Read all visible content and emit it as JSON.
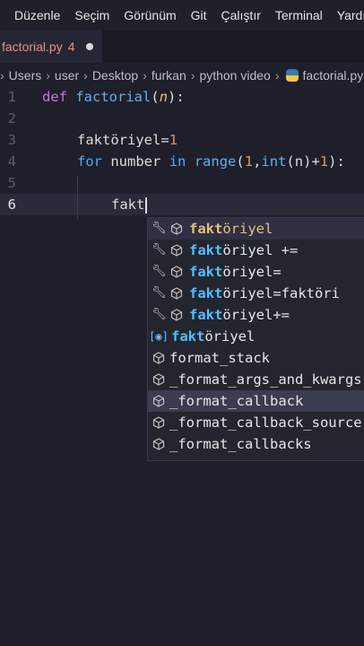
{
  "menu": [
    "Düzenle",
    "Seçim",
    "Görünüm",
    "Git",
    "Çalıştır",
    "Terminal",
    "Yardım"
  ],
  "tab": {
    "name": "factorial.py",
    "problems": "4"
  },
  "breadcrumb": [
    "Users",
    "user",
    "Desktop",
    "furkan",
    "python video",
    "factorial.py"
  ],
  "code": {
    "line_numbers": [
      "1",
      "2",
      "3",
      "4",
      "5",
      "6"
    ],
    "l1": {
      "def": "def",
      "fn": "factorial",
      "open": "(",
      "param": "n",
      "close": "):"
    },
    "l3": {
      "var": "faktöriyel",
      "eq": "=",
      "num": "1"
    },
    "l4": {
      "for": "for",
      "var": "number",
      "in": "in",
      "range": "range",
      "p1": "(",
      "one": "1",
      "comma": ",",
      "int": "int",
      "p2": "(",
      "n": "n",
      "p3": ")",
      "plus": "+",
      "one2": "1",
      "p4": "):"
    },
    "l6": {
      "typed": "fakt"
    }
  },
  "suggestions": [
    {
      "match": "fakt",
      "rest": "öriyel",
      "kind": "snippet-var"
    },
    {
      "match": "fakt",
      "rest": "öriyel +=",
      "kind": "snippet-var"
    },
    {
      "match": "fakt",
      "rest": "öriyel=",
      "kind": "snippet-var"
    },
    {
      "match": "fakt",
      "rest": "öriyel=faktöri",
      "kind": "snippet-var"
    },
    {
      "match": "fakt",
      "rest": "öriyel+=",
      "kind": "snippet-var"
    },
    {
      "match": "fakt",
      "rest": "öriyel",
      "kind": "variable"
    },
    {
      "text": "format_stack",
      "kind": "module"
    },
    {
      "text": "_format_args_and_kwargs",
      "kind": "module"
    },
    {
      "text": "_format_callback",
      "kind": "module"
    },
    {
      "text": "_format_callback_source",
      "kind": "module"
    },
    {
      "text": "_format_callbacks",
      "kind": "module"
    }
  ],
  "colors": {
    "accent": "#4fc1ff",
    "selected_text": "#e5c07b",
    "tab_error": "#f38b7e"
  }
}
